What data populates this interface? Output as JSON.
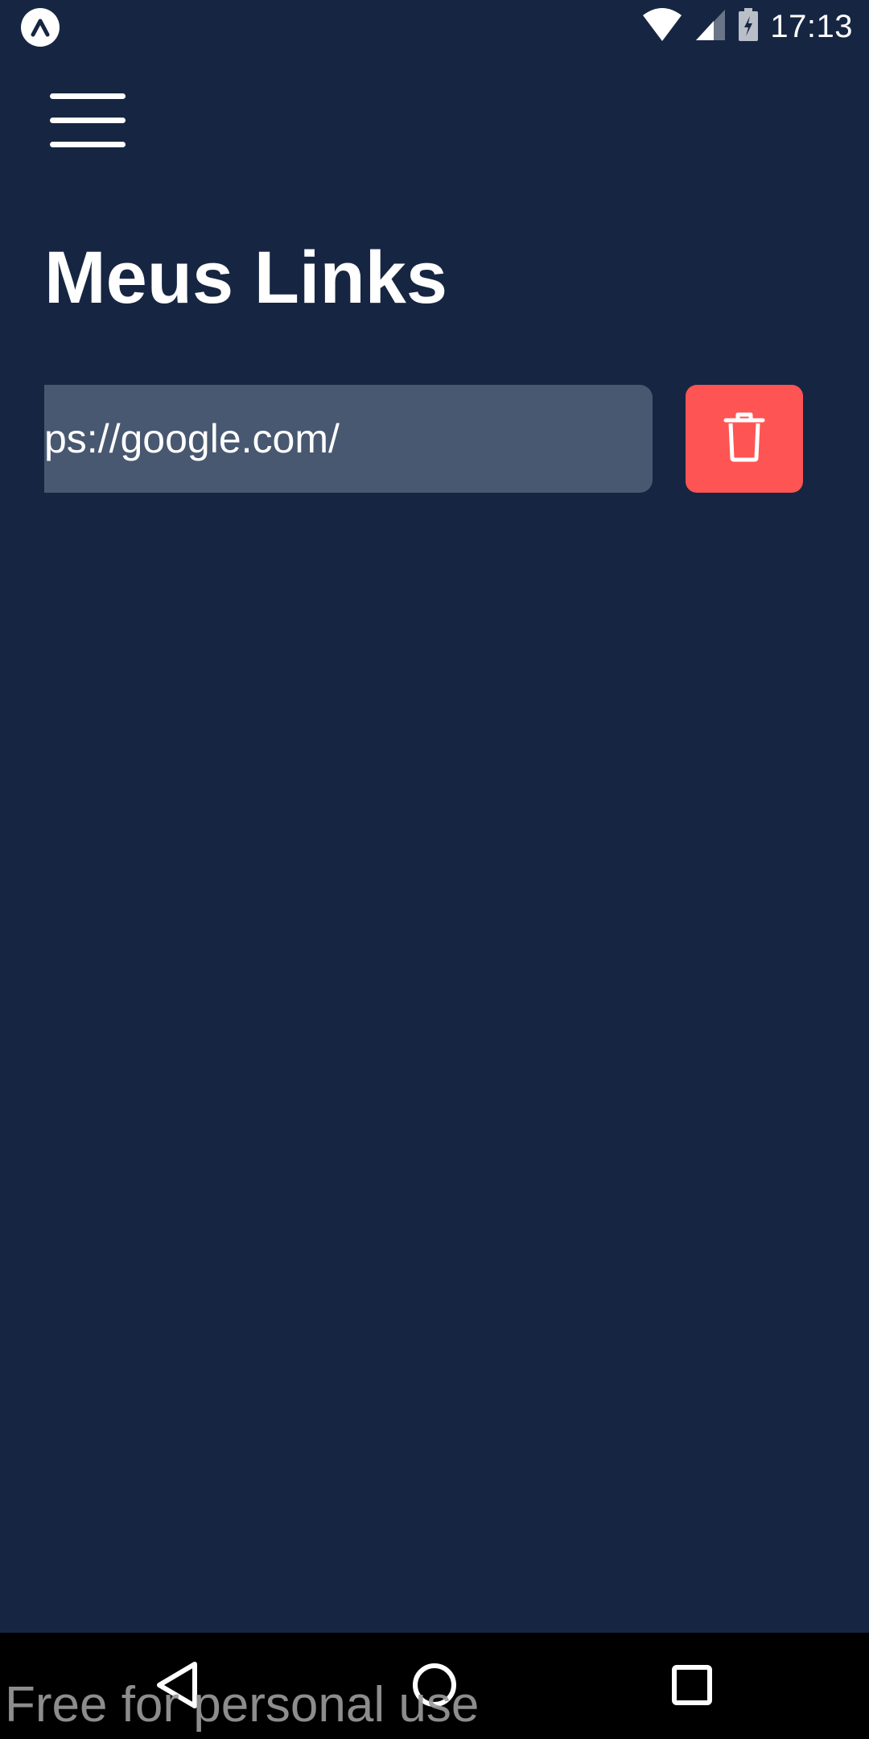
{
  "status_bar": {
    "time": "17:13",
    "icons": [
      "app-badge-icon",
      "wifi-icon",
      "cell-signal-icon",
      "battery-charging-icon"
    ]
  },
  "header": {
    "menu_icon": "hamburger-menu-icon",
    "title": "Meus Links"
  },
  "links": [
    {
      "url_visible": "ps://google.com/",
      "delete_icon": "trash-icon"
    }
  ],
  "nav_bar": {
    "buttons": [
      "back-icon",
      "home-icon",
      "recents-icon"
    ]
  },
  "watermark": "Free for personal use",
  "colors": {
    "background": "#162642",
    "field": "#485870",
    "delete": "#ff5454",
    "nav": "#000000"
  }
}
